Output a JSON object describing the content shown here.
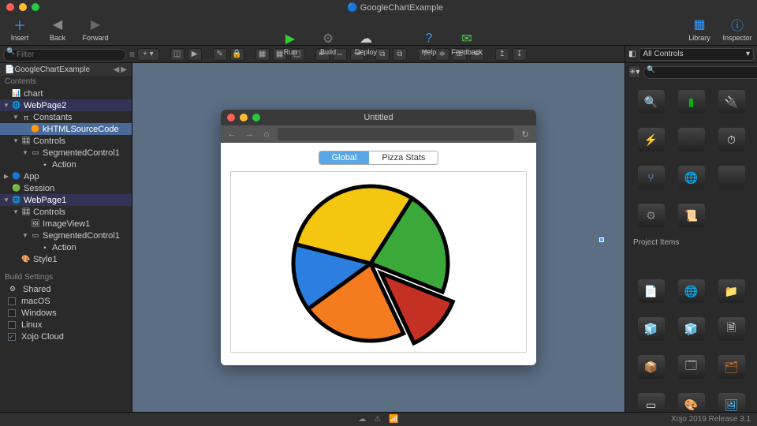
{
  "colors": {
    "accent": "#4aa3ff"
  },
  "titlebar": {
    "appIcon": "xojo-sphere-icon",
    "title": "GoogleChartExample"
  },
  "toolbar": {
    "left": [
      {
        "name": "insert",
        "label": "Insert",
        "icon": "insert-icon"
      },
      {
        "name": "back",
        "label": "Back",
        "icon": "back-icon"
      },
      {
        "name": "forward",
        "label": "Forward",
        "icon": "forward-icon"
      }
    ],
    "center": [
      {
        "name": "run",
        "label": "Run",
        "icon": "run-icon"
      },
      {
        "name": "build",
        "label": "Build",
        "icon": "build-icon"
      },
      {
        "name": "deploy",
        "label": "Deploy",
        "icon": "deploy-icon"
      }
    ],
    "centerRight": [
      {
        "name": "help",
        "label": "Help",
        "icon": "help-icon"
      },
      {
        "name": "feedback",
        "label": "Feedback",
        "icon": "feedback-icon"
      }
    ],
    "right": [
      {
        "name": "library",
        "label": "Library",
        "icon": "library-icon"
      },
      {
        "name": "inspector",
        "label": "Inspector",
        "icon": "inspector-icon"
      }
    ]
  },
  "filter": {
    "placeholder": "Filter"
  },
  "navigator": {
    "project": "GoogleChartExample",
    "contentsLabel": "Contents",
    "buildSettingsLabel": "Build Settings",
    "tree": [
      {
        "depth": 0,
        "icon": "chart-icon",
        "label": "chart",
        "tw": ""
      },
      {
        "depth": 0,
        "icon": "globe-icon",
        "label": "WebPage2",
        "tw": "▼",
        "sel": true
      },
      {
        "depth": 1,
        "icon": "pi-icon",
        "label": "Constants",
        "tw": "▼"
      },
      {
        "depth": 2,
        "icon": "const-icon",
        "label": "kHTMLSourceCode",
        "tw": "",
        "hl": true
      },
      {
        "depth": 1,
        "icon": "controls-icon",
        "label": "Controls",
        "tw": "▼"
      },
      {
        "depth": 2,
        "icon": "segmented-icon",
        "label": "SegmentedControl1",
        "tw": "▼"
      },
      {
        "depth": 3,
        "icon": "action-icon",
        "label": "Action",
        "tw": ""
      },
      {
        "depth": 0,
        "icon": "app-icon",
        "label": "App",
        "tw": "▶"
      },
      {
        "depth": 0,
        "icon": "session-icon",
        "label": "Session",
        "tw": ""
      },
      {
        "depth": 0,
        "icon": "globe-icon",
        "label": "WebPage1",
        "tw": "▼",
        "sel": true
      },
      {
        "depth": 1,
        "icon": "controls-icon",
        "label": "Controls",
        "tw": "▼"
      },
      {
        "depth": 2,
        "icon": "image-icon",
        "label": "ImageView1",
        "tw": ""
      },
      {
        "depth": 2,
        "icon": "segmented-icon",
        "label": "SegmentedControl1",
        "tw": "▼"
      },
      {
        "depth": 3,
        "icon": "action-icon",
        "label": "Action",
        "tw": ""
      },
      {
        "depth": 1,
        "icon": "style-icon",
        "label": "Style1",
        "tw": ""
      }
    ],
    "buildSettings": [
      {
        "label": "Shared",
        "icon": "shared-icon",
        "checkbox": false
      },
      {
        "label": "macOS",
        "icon": "macos-icon",
        "checked": false,
        "checkbox": true
      },
      {
        "label": "Windows",
        "icon": "windows-icon",
        "checked": false,
        "checkbox": true
      },
      {
        "label": "Linux",
        "icon": "linux-icon",
        "checked": false,
        "checkbox": true
      },
      {
        "label": "Xojo Cloud",
        "icon": "cloud-icon",
        "checked": true,
        "checkbox": true
      }
    ]
  },
  "previewWindow": {
    "title": "Untitled",
    "segments": [
      {
        "label": "Global",
        "active": true
      },
      {
        "label": "Pizza Stats",
        "active": false
      }
    ]
  },
  "chart_data": {
    "type": "pie",
    "title": "",
    "series": [
      {
        "name": "Yellow",
        "value": 30,
        "color": "#f4c60f"
      },
      {
        "name": "Green",
        "value": 22,
        "color": "#3aa93a"
      },
      {
        "name": "Red (exploded)",
        "value": 12,
        "color": "#c43023",
        "offset": true
      },
      {
        "name": "Orange",
        "value": 22,
        "color": "#f47c1e"
      },
      {
        "name": "Blue",
        "value": 14,
        "color": "#2a7fe0"
      }
    ]
  },
  "library": {
    "dropdown": "All Controls",
    "searchPlaceholder": "",
    "sectionLabel": "Project Items",
    "topItems": [
      {
        "name": "search-control-icon"
      },
      {
        "name": "terminal-icon"
      },
      {
        "name": "usb-icon"
      },
      {
        "name": "plug-icon"
      },
      {
        "name": "reel-icon"
      },
      {
        "name": "gauge-icon"
      },
      {
        "name": "branch-icon"
      },
      {
        "name": "globe-icon"
      },
      {
        "name": "code-icon"
      },
      {
        "name": "gear-icon"
      },
      {
        "name": "script-icon"
      }
    ],
    "projectItems": [
      {
        "name": "page-icon"
      },
      {
        "name": "webpage-icon"
      },
      {
        "name": "folder-icon"
      },
      {
        "name": "cube1-icon"
      },
      {
        "name": "cube2-icon"
      },
      {
        "name": "file-icon"
      },
      {
        "name": "box-icon"
      },
      {
        "name": "form-icon"
      },
      {
        "name": "asset-icon"
      },
      {
        "name": "card-icon"
      },
      {
        "name": "palette-icon"
      },
      {
        "name": "photos-icon"
      }
    ]
  },
  "statusbar": {
    "icons": [
      "cloud-sync-icon",
      "warning-icon",
      "wifi-icon"
    ],
    "version": "Xojo 2019 Release 3.1"
  }
}
